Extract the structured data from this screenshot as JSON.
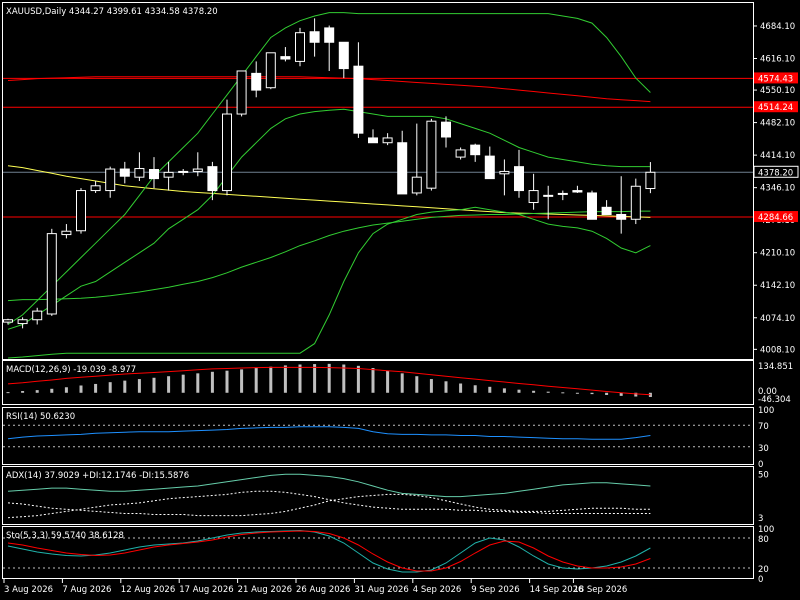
{
  "colors": {
    "background": "#000000",
    "frame": "#ffffff",
    "bull_body": "#000000",
    "bear_body": "#ffffff",
    "wick": "#ffffff",
    "ma_long": "#ffff55",
    "ma_mid": "#32cd32",
    "bollinger": "#32cd32",
    "resistance": "#ff0000",
    "current_price": "#708090",
    "macd_hist": "#c0c0c0",
    "macd_signal": "#ff0000",
    "rsi": "#1e90ff",
    "adx": "#66cdaa",
    "di": "#ffffff",
    "sto_main": "#20b2aa",
    "sto_signal": "#ff0000",
    "level_dash": "#c0c0c0"
  },
  "chart_data": {
    "type": "candlestick",
    "symbol_header": "XAUUSD,Daily  4344.27 4399.61 4334.58 4378.20",
    "ylim": [
      3990,
      4730
    ],
    "price_ticks": [
      "4684.10",
      "4616.10",
      "4550.10",
      "4482.10",
      "4414.10",
      "4346.10",
      "4278.10",
      "4210.10",
      "4142.10",
      "4074.10",
      "4008.10"
    ],
    "price_tick_values": [
      4684.1,
      4616.1,
      4550.1,
      4482.1,
      4414.1,
      4346.1,
      4278.1,
      4210.1,
      4142.1,
      4074.1,
      4008.1
    ],
    "current_price": {
      "label": "4378.20",
      "value": 4378.2
    },
    "levels": [
      {
        "label": "4574.43",
        "value": 4574.43
      },
      {
        "label": "4514.24",
        "value": 4514.24
      },
      {
        "label": "4284.66",
        "value": 4284.66
      }
    ],
    "x_labels": [
      "3 Aug 2026",
      "7 Aug 2026",
      "12 Aug 2026",
      "17 Aug 2026",
      "21 Aug 2026",
      "26 Aug 2026",
      "31 Aug 2026",
      "4 Sep 2026",
      "9 Sep 2026",
      "14 Sep 2026",
      "18 Sep 2026"
    ],
    "x_label_index": [
      0,
      4,
      8,
      12,
      16,
      20,
      24,
      28,
      32,
      36,
      39
    ],
    "candles": [
      [
        4065,
        4072,
        4060,
        4070
      ],
      [
        4062,
        4075,
        4052,
        4070
      ],
      [
        4070,
        4095,
        4060,
        4088
      ],
      [
        4082,
        4260,
        4078,
        4250
      ],
      [
        4248,
        4270,
        4240,
        4255
      ],
      [
        4256,
        4345,
        4250,
        4340
      ],
      [
        4340,
        4360,
        4335,
        4350
      ],
      [
        4340,
        4390,
        4325,
        4385
      ],
      [
        4385,
        4400,
        4355,
        4370
      ],
      [
        4368,
        4420,
        4360,
        4386
      ],
      [
        4384,
        4410,
        4345,
        4365
      ],
      [
        4368,
        4400,
        4340,
        4378
      ],
      [
        4378,
        4385,
        4372,
        4380
      ],
      [
        4380,
        4420,
        4370,
        4385
      ],
      [
        4390,
        4400,
        4320,
        4340
      ],
      [
        4340,
        4530,
        4330,
        4500
      ],
      [
        4500,
        4580,
        4495,
        4590
      ],
      [
        4585,
        4610,
        4535,
        4550
      ],
      [
        4555,
        4625,
        4552,
        4628
      ],
      [
        4620,
        4640,
        4610,
        4615
      ],
      [
        4610,
        4680,
        4600,
        4670
      ],
      [
        4672,
        4700,
        4620,
        4650
      ],
      [
        4680,
        4685,
        4590,
        4650
      ],
      [
        4650,
        4625,
        4575,
        4595
      ],
      [
        4600,
        4650,
        4450,
        4460
      ],
      [
        4450,
        4468,
        4440,
        4440
      ],
      [
        4440,
        4460,
        4435,
        4450
      ],
      [
        4440,
        4465,
        4390,
        4333
      ],
      [
        4335,
        4480,
        4330,
        4368
      ],
      [
        4345,
        4490,
        4340,
        4485
      ],
      [
        4483,
        4495,
        4430,
        4452
      ],
      [
        4410,
        4430,
        4405,
        4425
      ],
      [
        4435,
        4438,
        4400,
        4415
      ],
      [
        4412,
        4432,
        4380,
        4365
      ],
      [
        4375,
        4405,
        4330,
        4380
      ],
      [
        4390,
        4425,
        4325,
        4340
      ],
      [
        4315,
        4375,
        4300,
        4340
      ],
      [
        4330,
        4350,
        4280,
        4330
      ],
      [
        4332,
        4340,
        4320,
        4334
      ],
      [
        4340,
        4350,
        4335,
        4337
      ],
      [
        4335,
        4340,
        4330,
        4280
      ],
      [
        4305,
        4320,
        4300,
        4290
      ],
      [
        4290,
        4370,
        4250,
        4280
      ],
      [
        4280,
        4365,
        4270,
        4349
      ],
      [
        4344.27,
        4399.61,
        4334.58,
        4378.2
      ]
    ],
    "bollinger_upper": [
      4060,
      4080,
      4110,
      4140,
      4170,
      4200,
      4230,
      4260,
      4290,
      4330,
      4370,
      4400,
      4430,
      4460,
      4500,
      4540,
      4580,
      4620,
      4660,
      4680,
      4695,
      4705,
      4712,
      4712,
      4710,
      4710,
      4710,
      4710,
      4710,
      4710,
      4710,
      4710,
      4710,
      4710,
      4710,
      4710,
      4710,
      4710,
      4705,
      4700,
      4690,
      4660,
      4620,
      4575,
      4545
    ],
    "bollinger_middle": [
      4050,
      4060,
      4080,
      4100,
      4120,
      4140,
      4150,
      4170,
      4190,
      4210,
      4230,
      4260,
      4280,
      4300,
      4330,
      4370,
      4410,
      4440,
      4470,
      4490,
      4500,
      4505,
      4508,
      4510,
      4505,
      4500,
      4495,
      4495,
      4495,
      4495,
      4490,
      4480,
      4470,
      4460,
      4445,
      4430,
      4420,
      4410,
      4405,
      4400,
      4395,
      4392,
      4390,
      4390,
      4390
    ],
    "bollinger_lower": [
      3990,
      3992,
      3995,
      3998,
      4000,
      4000,
      4000,
      4000,
      4000,
      4000,
      4000,
      4000,
      4000,
      4000,
      4000,
      4000,
      4000,
      4000,
      4000,
      4000,
      4000,
      4020,
      4080,
      4150,
      4210,
      4250,
      4270,
      4280,
      4290,
      4295,
      4298,
      4300,
      4305,
      4300,
      4295,
      4290,
      4280,
      4270,
      4265,
      4262,
      4255,
      4240,
      4220,
      4210,
      4225
    ],
    "ma_mid": [
      4110,
      4112,
      4112,
      4113,
      4114,
      4115,
      4117,
      4120,
      4124,
      4128,
      4133,
      4138,
      4144,
      4150,
      4158,
      4168,
      4180,
      4190,
      4200,
      4212,
      4225,
      4235,
      4246,
      4255,
      4262,
      4268,
      4272,
      4276,
      4280,
      4284,
      4286,
      4288,
      4289,
      4290,
      4290,
      4291,
      4292,
      4293,
      4294,
      4295,
      4296,
      4296,
      4296,
      4297,
      4297
    ],
    "ma_long": [
      4392,
      4388,
      4382,
      4376,
      4370,
      4365,
      4360,
      4355,
      4350,
      4347,
      4344,
      4341,
      4338,
      4336,
      4334,
      4332,
      4330,
      4328,
      4326,
      4324,
      4322,
      4320,
      4318,
      4316,
      4314,
      4312,
      4310,
      4308,
      4306,
      4304,
      4302,
      4300,
      4298,
      4296,
      4294,
      4293,
      4292,
      4291,
      4290,
      4289,
      4288,
      4287,
      4286,
      4285,
      4284
    ],
    "resistance_curve": [
      4570,
      4572,
      4574,
      4575,
      4576,
      4577,
      4578,
      4578,
      4578,
      4578,
      4578,
      4578,
      4578,
      4578,
      4578,
      4578,
      4578,
      4578,
      4578,
      4578,
      4578,
      4577,
      4576,
      4575,
      4574,
      4572,
      4570,
      4568,
      4566,
      4564,
      4562,
      4560,
      4558,
      4556,
      4553,
      4550,
      4547,
      4544,
      4541,
      4538,
      4535,
      4532,
      4530,
      4528,
      4526
    ],
    "macd": {
      "label": "MACD(12,26,9) -19.039 -8.977",
      "ticks": [
        "134.851",
        "0.00",
        "-46.304"
      ],
      "ylim": [
        -46.304,
        134.851
      ],
      "hist": [
        3,
        8,
        12,
        18,
        25,
        33,
        40,
        48,
        55,
        62,
        68,
        75,
        82,
        88,
        95,
        100,
        106,
        112,
        118,
        124,
        128,
        130,
        131,
        128,
        122,
        112,
        100,
        88,
        75,
        62,
        52,
        42,
        34,
        27,
        20,
        14,
        9,
        5,
        2,
        -2,
        -6,
        -10,
        -14,
        -17,
        -19
      ],
      "signal": [
        40,
        45,
        52,
        58,
        65,
        70,
        75,
        80,
        85,
        88,
        92,
        96,
        100,
        104,
        108,
        110,
        112,
        114,
        115,
        115,
        115,
        115,
        114,
        112,
        110,
        105,
        100,
        95,
        88,
        82,
        75,
        68,
        62,
        55,
        49,
        42,
        36,
        30,
        24,
        18,
        12,
        6,
        0,
        -5,
        -9
      ]
    },
    "rsi": {
      "label": "RSI(14) 50.6230",
      "ticks": [
        "100",
        "70",
        "30",
        "0"
      ],
      "levels": [
        70,
        30
      ],
      "values": [
        45,
        48,
        50,
        51,
        52,
        53,
        55,
        56,
        57,
        58,
        58,
        58,
        59,
        60,
        61,
        62,
        64,
        65,
        66,
        66,
        67,
        67,
        67,
        66,
        64,
        58,
        54,
        53,
        53,
        52,
        52,
        51,
        51,
        49,
        49,
        48,
        47,
        46,
        45,
        45,
        44,
        44,
        44,
        47,
        51
      ]
    },
    "adx": {
      "label": "ADX(14) 37.9029 +DI:12.1746 -DI:15.5876",
      "ticks": [
        "50",
        "3"
      ],
      "adx": [
        33,
        34,
        35,
        36,
        36,
        35,
        34,
        33,
        33,
        34,
        35,
        36,
        37,
        38,
        40,
        42,
        44,
        46,
        48,
        49,
        49,
        48,
        47,
        45,
        42,
        38,
        34,
        31,
        30,
        29,
        28,
        28,
        29,
        30,
        31,
        33,
        35,
        37,
        39,
        40,
        41,
        41,
        40,
        39,
        38
      ],
      "plus_di": [
        8,
        9,
        10,
        12,
        14,
        16,
        18,
        20,
        21,
        22,
        24,
        26,
        27,
        28,
        29,
        30,
        32,
        33,
        33,
        32,
        30,
        28,
        25,
        22,
        20,
        18,
        17,
        16,
        16,
        16,
        16,
        15,
        15,
        14,
        14,
        13,
        13,
        12,
        12,
        12,
        12,
        12,
        12,
        12,
        12
      ],
      "minus_di": [
        22,
        21,
        19,
        17,
        16,
        15,
        14,
        13,
        12,
        12,
        11,
        11,
        11,
        10,
        10,
        10,
        10,
        11,
        12,
        14,
        17,
        20,
        24,
        26,
        28,
        29,
        30,
        30,
        29,
        27,
        24,
        21,
        18,
        16,
        15,
        14,
        14,
        14,
        15,
        16,
        17,
        17,
        17,
        16,
        16
      ]
    },
    "stochastic": {
      "label": "Sto(5,3,3) 59.5740 38.6128",
      "ticks": [
        "100",
        "80",
        "20",
        "0"
      ],
      "levels": [
        80,
        20
      ],
      "main": [
        64,
        58,
        52,
        48,
        45,
        44,
        46,
        50,
        56,
        62,
        66,
        68,
        70,
        74,
        80,
        86,
        90,
        92,
        93,
        94,
        95,
        92,
        84,
        70,
        50,
        30,
        18,
        12,
        12,
        16,
        30,
        50,
        70,
        80,
        76,
        62,
        44,
        28,
        20,
        18,
        20,
        24,
        32,
        44,
        60
      ],
      "signal": [
        70,
        66,
        60,
        55,
        50,
        47,
        45,
        46,
        50,
        56,
        62,
        66,
        69,
        72,
        76,
        82,
        87,
        90,
        92,
        93,
        94,
        93,
        89,
        80,
        66,
        48,
        32,
        20,
        14,
        14,
        20,
        33,
        50,
        66,
        74,
        72,
        60,
        44,
        32,
        24,
        20,
        20,
        22,
        28,
        39
      ]
    }
  }
}
